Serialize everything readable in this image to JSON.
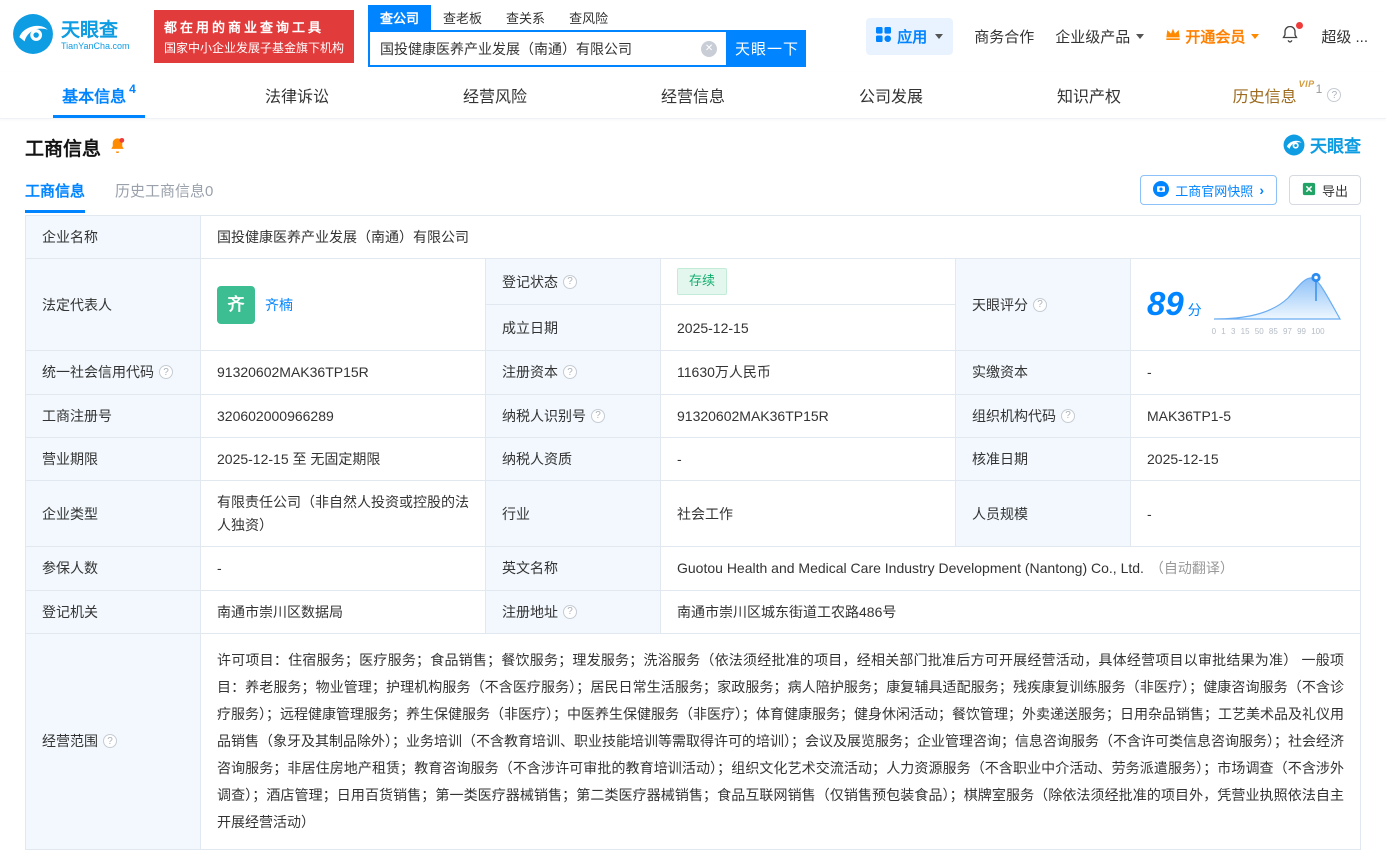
{
  "header": {
    "logo": {
      "name": "天眼查",
      "domain": "TianYanCha.com"
    },
    "banner": {
      "line1": "都在用的商业查询工具",
      "line2": "国家中小企业发展子基金旗下机构"
    },
    "search": {
      "tabs": [
        "查公司",
        "查老板",
        "查关系",
        "查风险"
      ],
      "value": "国投健康医养产业发展（南通）有限公司",
      "button": "天眼一下"
    },
    "nav": {
      "apps": "应用",
      "cooperation": "商务合作",
      "enterprise": "企业级产品",
      "vip": "开通会员",
      "super": "超级 ..."
    }
  },
  "tabs": {
    "basic": "基本信息",
    "basic_count": "4",
    "legal": "法律诉讼",
    "risk": "经营风险",
    "operation": "经营信息",
    "development": "公司发展",
    "ip": "知识产权",
    "history": "历史信息",
    "history_count": "1",
    "history_vip": "VIP"
  },
  "section": {
    "title": "工商信息",
    "brand": "天眼查",
    "subtab_active": "工商信息",
    "subtab_history": "历史工商信息0",
    "snapshot_btn": "工商官网快照",
    "export_btn": "导出"
  },
  "table": {
    "labels": {
      "name": "企业名称",
      "legal_rep": "法定代表人",
      "status": "登记状态",
      "establish": "成立日期",
      "score": "天眼评分",
      "credit_code": "统一社会信用代码",
      "reg_capital": "注册资本",
      "paid_capital": "实缴资本",
      "reg_no": "工商注册号",
      "taxpayer_no": "纳税人识别号",
      "org_code": "组织机构代码",
      "term": "营业期限",
      "taxpayer_qualification": "纳税人资质",
      "approval_date": "核准日期",
      "type": "企业类型",
      "industry": "行业",
      "staff": "人员规模",
      "insured": "参保人数",
      "english": "英文名称",
      "authority": "登记机关",
      "address": "注册地址",
      "scope": "经营范围"
    },
    "values": {
      "name": "国投健康医养产业发展（南通）有限公司",
      "legal_rep": "齐楠",
      "legal_rep_avatar": "齐",
      "status": "存续",
      "establish": "2025-12-15",
      "score": "89",
      "score_unit": "分",
      "score_axis": "0 1 3 15 50 85 97 99 100",
      "credit_code": "91320602MAK36TP15R",
      "reg_capital": "11630万人民币",
      "paid_capital": "-",
      "reg_no": "320602000966289",
      "taxpayer_no": "91320602MAK36TP15R",
      "org_code": "MAK36TP1-5",
      "term": "2025-12-15 至 无固定期限",
      "taxpayer_qualification": "-",
      "approval_date": "2025-12-15",
      "type": "有限责任公司（非自然人投资或控股的法人独资）",
      "industry": "社会工作",
      "staff": "-",
      "insured": "-",
      "english": "Guotou Health and Medical Care Industry Development (Nantong) Co., Ltd.",
      "english_note": "（自动翻译）",
      "authority": "南通市崇川区数据局",
      "address": "南通市崇川区城东街道工农路486号",
      "scope": "许可项目：住宿服务；医疗服务；食品销售；餐饮服务；理发服务；洗浴服务（依法须经批准的项目，经相关部门批准后方可开展经营活动，具体经营项目以审批结果为准） 一般项目：养老服务；物业管理；护理机构服务（不含医疗服务）；居民日常生活服务；家政服务；病人陪护服务；康复辅具适配服务；残疾康复训练服务（非医疗）；健康咨询服务（不含诊疗服务）；远程健康管理服务；养生保健服务（非医疗）；中医养生保健服务（非医疗）；体育健康服务；健身休闲活动；餐饮管理；外卖递送服务；日用杂品销售；工艺美术品及礼仪用品销售（象牙及其制品除外）；业务培训（不含教育培训、职业技能培训等需取得许可的培训）；会议及展览服务；企业管理咨询；信息咨询服务（不含许可类信息咨询服务）；社会经济咨询服务；非居住房地产租赁；教育咨询服务（不含涉许可审批的教育培训活动）；组织文化艺术交流活动；人力资源服务（不含职业中介活动、劳务派遣服务）；市场调查（不含涉外调查）；酒店管理；日用百货销售；第一类医疗器械销售；第二类医疗器械销售；食品互联网销售（仅销售预包装食品）；棋牌室服务（除依法须经批准的项目外，凭营业执照依法自主开展经营活动）"
    }
  }
}
